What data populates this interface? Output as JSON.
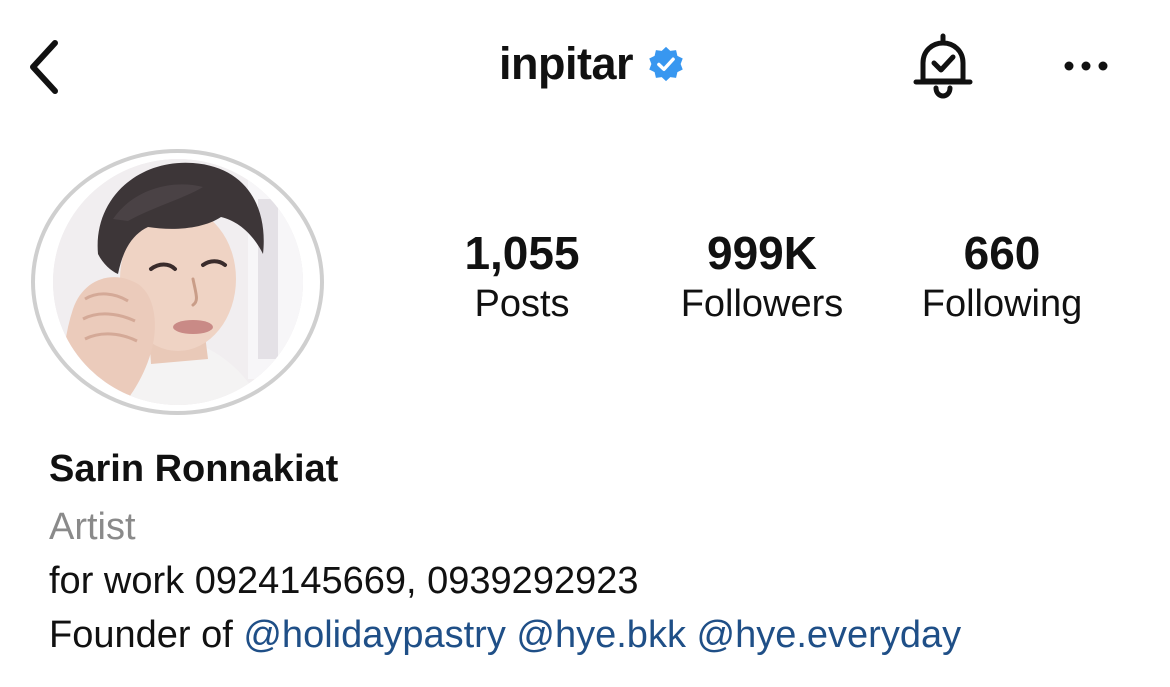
{
  "header": {
    "username": "inpitar",
    "verified": true,
    "back_icon": "chevron-left-icon",
    "bell_icon": "bell-check-icon",
    "more_icon": "more-horizontal-icon"
  },
  "stats": {
    "posts": {
      "value": "1,055",
      "label": "Posts"
    },
    "followers": {
      "value": "999K",
      "label": "Followers"
    },
    "following": {
      "value": "660",
      "label": "Following"
    }
  },
  "profile": {
    "full_name": "Sarin Ronnakiat",
    "category": "Artist",
    "bio_line_1": "for work 0924145669, 0939292923",
    "bio_line_2_prefix": "Founder of",
    "mentions": [
      "@holidaypastry",
      "@hye.bkk",
      "@hye.everyday"
    ]
  },
  "colors": {
    "verified_blue": "#3897f0",
    "mention_link": "#1f4f87",
    "secondary_text": "#8a8a8a",
    "avatar_ring": "#cfcfcf"
  }
}
